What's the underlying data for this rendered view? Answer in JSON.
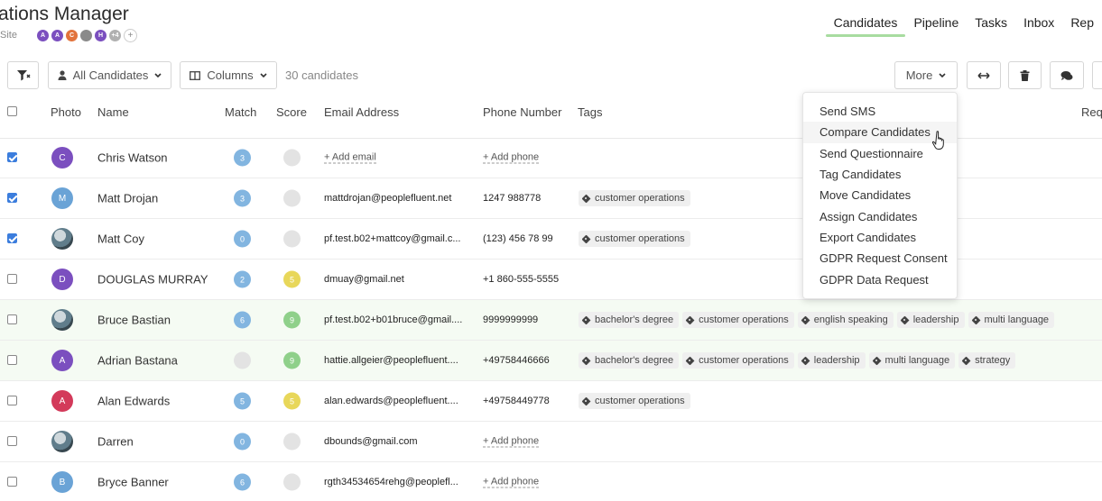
{
  "header": {
    "title": "ations Manager",
    "site_label": "Site",
    "avatars": [
      {
        "initial": "A",
        "color": "#7b4fbf"
      },
      {
        "initial": "A",
        "color": "#7b4fbf"
      },
      {
        "initial": "C",
        "color": "#e2733c"
      },
      {
        "initial": "",
        "color": "#8a8a8a"
      },
      {
        "initial": "H",
        "color": "#7b4fbf"
      },
      {
        "initial": "+4",
        "color": "#b0b0b0"
      }
    ],
    "add_member": "+"
  },
  "nav": {
    "tabs": [
      {
        "label": "Candidates",
        "active": true
      },
      {
        "label": "Pipeline"
      },
      {
        "label": "Tasks"
      },
      {
        "label": "Inbox"
      },
      {
        "label": "Rep"
      }
    ]
  },
  "toolbar": {
    "filter_icon": "filter-clear-icon",
    "all_candidates": "All Candidates",
    "columns": "Columns",
    "count": "30 candidates",
    "more": "More"
  },
  "table": {
    "headers": {
      "photo": "Photo",
      "name": "Name",
      "match": "Match",
      "score": "Score",
      "email": "Email Address",
      "phone": "Phone Number",
      "tags": "Tags",
      "req": "Requ"
    },
    "rows": [
      {
        "checked": true,
        "initial": "C",
        "color": "#7b4fbf",
        "name": "Chris Watson",
        "match": "3",
        "score": "",
        "email": "",
        "email_add": "+ Add email",
        "phone": "",
        "phone_add": "+ Add phone",
        "tags": []
      },
      {
        "checked": true,
        "initial": "M",
        "color": "#6aa3d6",
        "name": "Matt Drojan",
        "match": "3",
        "score": "",
        "email": "mattdrojan@peoplefluent.net",
        "phone": "1247 988778",
        "tags": [
          "customer operations"
        ]
      },
      {
        "checked": true,
        "initial": "",
        "photo": true,
        "name": "Matt Coy",
        "match": "0",
        "score": "",
        "email": "pf.test.b02+mattcoy@gmail.c...",
        "phone": "(123) 456 78 99",
        "tags": [
          "customer operations"
        ]
      },
      {
        "checked": false,
        "initial": "D",
        "color": "#7b4fbf",
        "name": "DOUGLAS MURRAY",
        "match": "2",
        "score": "5",
        "score_color": "yellow",
        "email": "dmuay@gmail.net",
        "phone": "+1 860-555-5555",
        "tags": []
      },
      {
        "checked": false,
        "initial": "",
        "photo": true,
        "name": "Bruce Bastian",
        "match": "6",
        "score": "9",
        "score_color": "green",
        "email": "pf.test.b02+b01bruce@gmail....",
        "phone": "9999999999",
        "tags": [
          "bachelor's degree",
          "customer operations",
          "english speaking",
          "leadership",
          "multi language"
        ],
        "highlight": true
      },
      {
        "checked": false,
        "initial": "A",
        "color": "#7b4fbf",
        "name": "Adrian Bastana",
        "match": "",
        "score": "9",
        "score_color": "green",
        "email": "hattie.allgeier@peoplefluent....",
        "phone": "+49758446666",
        "tags": [
          "bachelor's degree",
          "customer operations",
          "leadership",
          "multi language",
          "strategy"
        ],
        "highlight": true
      },
      {
        "checked": false,
        "initial": "A",
        "color": "#d33a5a",
        "name": "Alan Edwards",
        "match": "5",
        "score": "5",
        "score_color": "yellow",
        "email": "alan.edwards@peoplefluent....",
        "phone": "+49758449778",
        "tags": [
          "customer operations"
        ]
      },
      {
        "checked": false,
        "initial": "",
        "photo": true,
        "name": "Darren",
        "match": "0",
        "score": "",
        "email": "dbounds@gmail.com",
        "phone": "",
        "phone_add": "+ Add phone",
        "tags": []
      },
      {
        "checked": false,
        "initial": "B",
        "color": "#6aa3d6",
        "name": "Bryce Banner",
        "match": "6",
        "score": "",
        "email": "rgth34534654rehg@peoplefl...",
        "phone": "",
        "phone_add": "+ Add phone",
        "tags": []
      }
    ]
  },
  "more_menu": {
    "items": [
      "Send SMS",
      "Compare Candidates",
      "Send Questionnaire",
      "Tag Candidates",
      "Move Candidates",
      "Assign Candidates",
      "Export Candidates",
      "GDPR Request Consent",
      "GDPR Data Request"
    ],
    "hovered_index": 1
  }
}
